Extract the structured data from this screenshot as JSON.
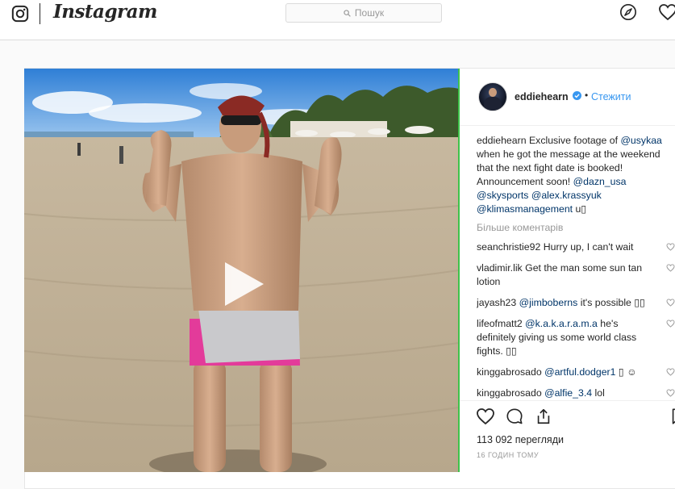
{
  "nav": {
    "wordmark": "Instagram",
    "search_placeholder": "Пошук",
    "icons": [
      "instagram-glyph-icon",
      "search-icon",
      "compass-icon",
      "heart-icon"
    ]
  },
  "post": {
    "author": "eddiehearn",
    "follow_label": "Стежити",
    "separator": "•",
    "caption": {
      "user": "eddiehearn",
      "text_1": "Exclusive footage of",
      "mention_1": "@usykaa",
      "text_2": "when he got the message at the weekend that the next fight date is booked! Announcement soon!",
      "mention_2": "@dazn_usa",
      "mention_3": "@skysports",
      "mention_4": "@alex.krassyuk",
      "mention_5": "@klimasmanagement",
      "tail": "u▯"
    },
    "more_comments_label": "Більше коментарів",
    "comments": [
      {
        "user": "seanchristie92",
        "text": "Hurry up, I can't wait"
      },
      {
        "user": "vladimir.lik",
        "text": "Get the man some sun tan lotion"
      },
      {
        "user": "jayash23",
        "mention": "@jimboberns",
        "text": "it's possible ▯▯"
      },
      {
        "user": "lifeofmatt2",
        "mention": "@k.a.k.a.r.a.m.a",
        "text": "he's definitely giving us some world class fights. ▯▯"
      },
      {
        "user": "kinggabrosado",
        "mention": "@artful.dodger1",
        "text": "▯ ☺"
      },
      {
        "user": "kinggabrosado",
        "mention": "@alfie_3.4",
        "text": "lol"
      }
    ],
    "views": "113 092 перегляди",
    "timestamp": "16 ГОДИН ТОМУ"
  },
  "colors": {
    "link": "#003569",
    "follow": "#3897f0",
    "video_border": "#3ec34a",
    "secondary_text": "#999999"
  }
}
